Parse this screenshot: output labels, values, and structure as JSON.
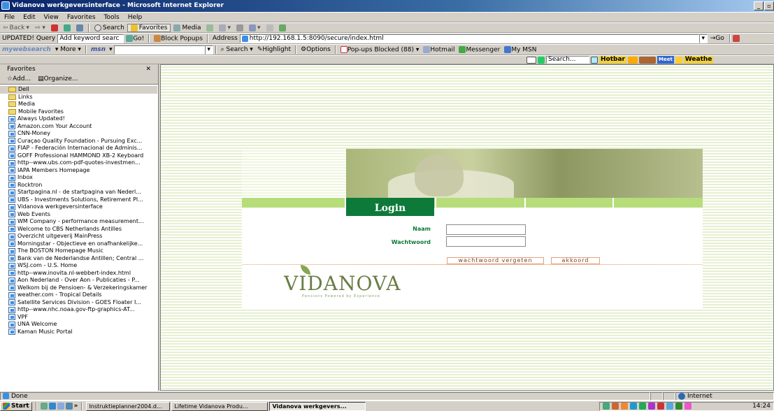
{
  "window": {
    "title": "Vidanova werkgeversinterface - Microsoft Internet Explorer"
  },
  "menu": [
    "File",
    "Edit",
    "View",
    "Favorites",
    "Tools",
    "Help"
  ],
  "toolbar": {
    "back": "Back",
    "search": "Search",
    "favorites": "Favorites",
    "media": "Media"
  },
  "addressbar": {
    "updated_label": "UPDATED! Query",
    "keyword_placeholder": "Add keyword searc",
    "go1": "Go!",
    "block_popups": "Block Popups",
    "address_label": "Address",
    "url": "http://192.168.1.5:8090/secure/index.html",
    "go": "Go"
  },
  "msnbar": {
    "websearch": "mywebsearch",
    "more": "More",
    "msn": "msn",
    "search": "Search",
    "highlight": "Highlight",
    "options": "Options",
    "popups": "Pop-ups Blocked (88)",
    "hotmail": "Hotmail",
    "messenger": "Messenger",
    "mymsn": "My MSN"
  },
  "linkbar": {
    "search_placeholder": "Search...",
    "hotbar": "Hotbar",
    "meet": "Meet",
    "weather": "Weathe"
  },
  "favorites": {
    "title": "Favorites",
    "add": "Add...",
    "organize": "Organize...",
    "items": [
      {
        "label": "Dell",
        "type": "folder"
      },
      {
        "label": "Links",
        "type": "folder"
      },
      {
        "label": "Media",
        "type": "folder"
      },
      {
        "label": "Mobile Favorites",
        "type": "folder"
      },
      {
        "label": "Always Updated!",
        "type": "page"
      },
      {
        "label": "Amazon.com Your Account",
        "type": "page"
      },
      {
        "label": "CNN-Money",
        "type": "page"
      },
      {
        "label": "Curaçao Quality Foundation - Pursuing Exc...",
        "type": "page"
      },
      {
        "label": "FIAP - Federación Internacional de Adminis...",
        "type": "page"
      },
      {
        "label": "GOFF Professional HAMMOND XB-2 Keyboard",
        "type": "page"
      },
      {
        "label": "http--www.ubs.com-pdf-quotes-investmen...",
        "type": "page"
      },
      {
        "label": "IAPA Members Homepage",
        "type": "page"
      },
      {
        "label": "Inbox",
        "type": "page"
      },
      {
        "label": "Rocktron",
        "type": "page"
      },
      {
        "label": "Startpagina.nl - de startpagina van Nederl...",
        "type": "page"
      },
      {
        "label": "UBS - Investments Solutions, Retirement Pl...",
        "type": "page"
      },
      {
        "label": "Vidanova werkgeversinterface",
        "type": "page"
      },
      {
        "label": "Web Events",
        "type": "page"
      },
      {
        "label": "WM Company - performance measurement...",
        "type": "page"
      },
      {
        "label": "Welcome to CBS Netherlands Antilles",
        "type": "page"
      },
      {
        "label": "Overzicht uitgeverij MainPress",
        "type": "page"
      },
      {
        "label": "Morningstar - Objectieve en onafhankelijke...",
        "type": "page"
      },
      {
        "label": "The BOSTON Homepage Music",
        "type": "page"
      },
      {
        "label": "Bank van de Nederlandse Antillen; Central ...",
        "type": "page"
      },
      {
        "label": "WSJ.com - U.S. Home",
        "type": "page"
      },
      {
        "label": "http--www.inovita.nl-webbert-index.html",
        "type": "page"
      },
      {
        "label": "Aon Nederland - Over Aon - Publicaties - P...",
        "type": "page"
      },
      {
        "label": "Welkom bij de Pensioen- & Verzekeringskamer",
        "type": "page"
      },
      {
        "label": "weather.com - Tropical Details",
        "type": "page"
      },
      {
        "label": "Satellite Services Division - GOES Floater I...",
        "type": "page"
      },
      {
        "label": "http--www.nhc.noaa.gov-ftp-graphics-AT...",
        "type": "page"
      },
      {
        "label": "VPF",
        "type": "page"
      },
      {
        "label": "UNA Welcome",
        "type": "page"
      },
      {
        "label": "Kaman Music Portal",
        "type": "page"
      }
    ]
  },
  "login": {
    "title": "Login",
    "naam_label": "Naam",
    "wachtwoord_label": "Wachtwoord",
    "forgot_button": "wachtwoord vergeten",
    "submit_button": "akkoord",
    "logo_text": "VIDANOVA",
    "logo_tagline": "Pensions Powered by Experience"
  },
  "status": {
    "text": "Done",
    "zone": "Internet"
  },
  "taskbar": {
    "start": "Start",
    "tasks": [
      "Instruktieplanner2004.d...",
      "Lifetime Vidanova Produ...",
      "Vidanova werkgevers..."
    ],
    "clock": "14:24"
  },
  "colors": {
    "brand_green": "#0d7a39",
    "light_green": "#b7dd7a",
    "title_blue": "#0a246a"
  }
}
